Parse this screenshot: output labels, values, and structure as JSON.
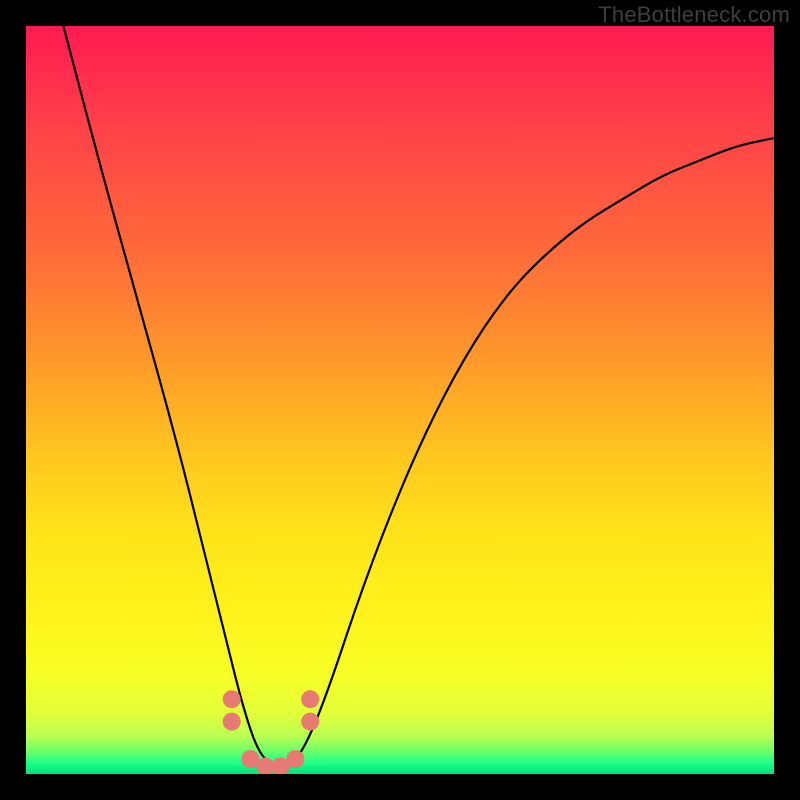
{
  "watermark": "TheBottleneck.com",
  "chart_data": {
    "type": "line",
    "title": "",
    "xlabel": "",
    "ylabel": "",
    "xlim": [
      0,
      100
    ],
    "ylim": [
      0,
      100
    ],
    "grid": false,
    "legend": false,
    "annotations": [
      "TheBottleneck.com"
    ],
    "series": [
      {
        "name": "bottleneck-curve",
        "x": [
          5,
          10,
          15,
          20,
          24,
          27,
          29,
          31,
          33,
          35,
          37,
          40,
          45,
          50,
          55,
          60,
          65,
          70,
          75,
          80,
          85,
          90,
          95,
          100
        ],
        "y": [
          100,
          81,
          63,
          45,
          29,
          17,
          9,
          3,
          1,
          1,
          3,
          10,
          25,
          38,
          49,
          58,
          65,
          70,
          74,
          77,
          80,
          82,
          84,
          85
        ]
      },
      {
        "name": "bottom-markers",
        "type": "scatter",
        "x": [
          27.5,
          27.5,
          30,
          32,
          34,
          36,
          38,
          38
        ],
        "y": [
          10,
          7,
          2,
          1,
          1,
          2,
          7,
          10
        ]
      }
    ],
    "color_stops": [
      {
        "pos": 0,
        "color": "#ff1a52"
      },
      {
        "pos": 0.45,
        "color": "#ff9a2a"
      },
      {
        "pos": 0.78,
        "color": "#fff21a"
      },
      {
        "pos": 0.95,
        "color": "#b8ff52"
      },
      {
        "pos": 1.0,
        "color": "#00e07a"
      }
    ]
  }
}
